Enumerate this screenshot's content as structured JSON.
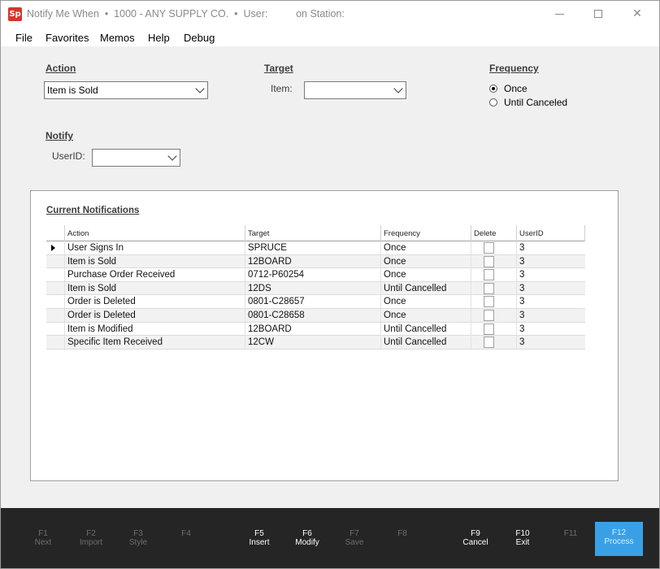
{
  "window": {
    "logo_text": "Sp",
    "title": "Notify Me When  •  1000 - ANY SUPPLY CO.  •  User:          on Station:",
    "min_glyph": "",
    "max_glyph": "",
    "close_glyph": "✕"
  },
  "menu": [
    "File",
    "Favorites",
    "Memos",
    "Help",
    "Debug"
  ],
  "action": {
    "section_title": "Action",
    "value": "Item is Sold"
  },
  "target": {
    "section_title": "Target",
    "item_label": "Item:",
    "item_value": ""
  },
  "frequency": {
    "section_title": "Frequency",
    "options": [
      {
        "label": "Once",
        "selected": true
      },
      {
        "label": "Until Canceled",
        "selected": false
      }
    ]
  },
  "notify": {
    "section_title": "Notify",
    "userid_label": "UserID:",
    "userid_value": ""
  },
  "notifications": {
    "section_title": "Current Notifications",
    "columns": [
      "Action",
      "Target",
      "Frequency",
      "Delete",
      "UserID"
    ],
    "rows": [
      {
        "action": "User Signs In",
        "target": "SPRUCE",
        "frequency": "Once",
        "userid": "3",
        "current": true
      },
      {
        "action": "Item is Sold",
        "target": "12BOARD",
        "frequency": "Once",
        "userid": "3"
      },
      {
        "action": "Purchase Order Received",
        "target": "0712-P60254",
        "frequency": "Once",
        "userid": "3"
      },
      {
        "action": "Item is Sold",
        "target": "12DS",
        "frequency": "Until Cancelled",
        "userid": "3"
      },
      {
        "action": "Order is Deleted",
        "target": "0801-C28657",
        "frequency": "Once",
        "userid": "3"
      },
      {
        "action": "Order is Deleted",
        "target": "0801-C28658",
        "frequency": "Once",
        "userid": "3"
      },
      {
        "action": "Item is Modified",
        "target": "12BOARD",
        "frequency": "Until Cancelled",
        "userid": "3"
      },
      {
        "action": "Specific Item Received",
        "target": "12CW",
        "frequency": "Until Cancelled",
        "userid": "3"
      }
    ]
  },
  "function_keys": [
    {
      "key": "F1",
      "label": "Next",
      "enabled": false
    },
    {
      "key": "F2",
      "label": "Import",
      "enabled": false
    },
    {
      "key": "F3",
      "label": "Style",
      "enabled": false
    },
    {
      "key": "F4",
      "label": "",
      "enabled": false
    },
    {
      "key": "F5",
      "label": "Insert",
      "enabled": true
    },
    {
      "key": "F6",
      "label": "Modify",
      "enabled": true
    },
    {
      "key": "F7",
      "label": "Save",
      "enabled": false
    },
    {
      "key": "F8",
      "label": "",
      "enabled": false
    },
    {
      "key": "F9",
      "label": "Cancel",
      "enabled": true
    },
    {
      "key": "F10",
      "label": "Exit",
      "enabled": true
    },
    {
      "key": "F11",
      "label": "",
      "enabled": false
    },
    {
      "key": "F12",
      "label": "Process",
      "enabled": true
    }
  ],
  "colors": {
    "accent": "#3aa0e6",
    "footer_bg": "#252525",
    "logo": "#d9342b"
  }
}
